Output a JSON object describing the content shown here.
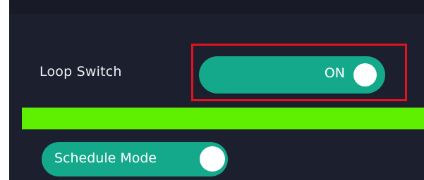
{
  "loop_switch": {
    "label": "Loop Switch",
    "state_text": "ON",
    "on": true
  },
  "schedule_mode": {
    "label": "Schedule Mode",
    "on": true
  },
  "colors": {
    "panel_background": "#1c1f2d",
    "toggle_on": "#13a98a",
    "divider_bar": "#5ef000",
    "highlight_outline": "#e3131d"
  }
}
